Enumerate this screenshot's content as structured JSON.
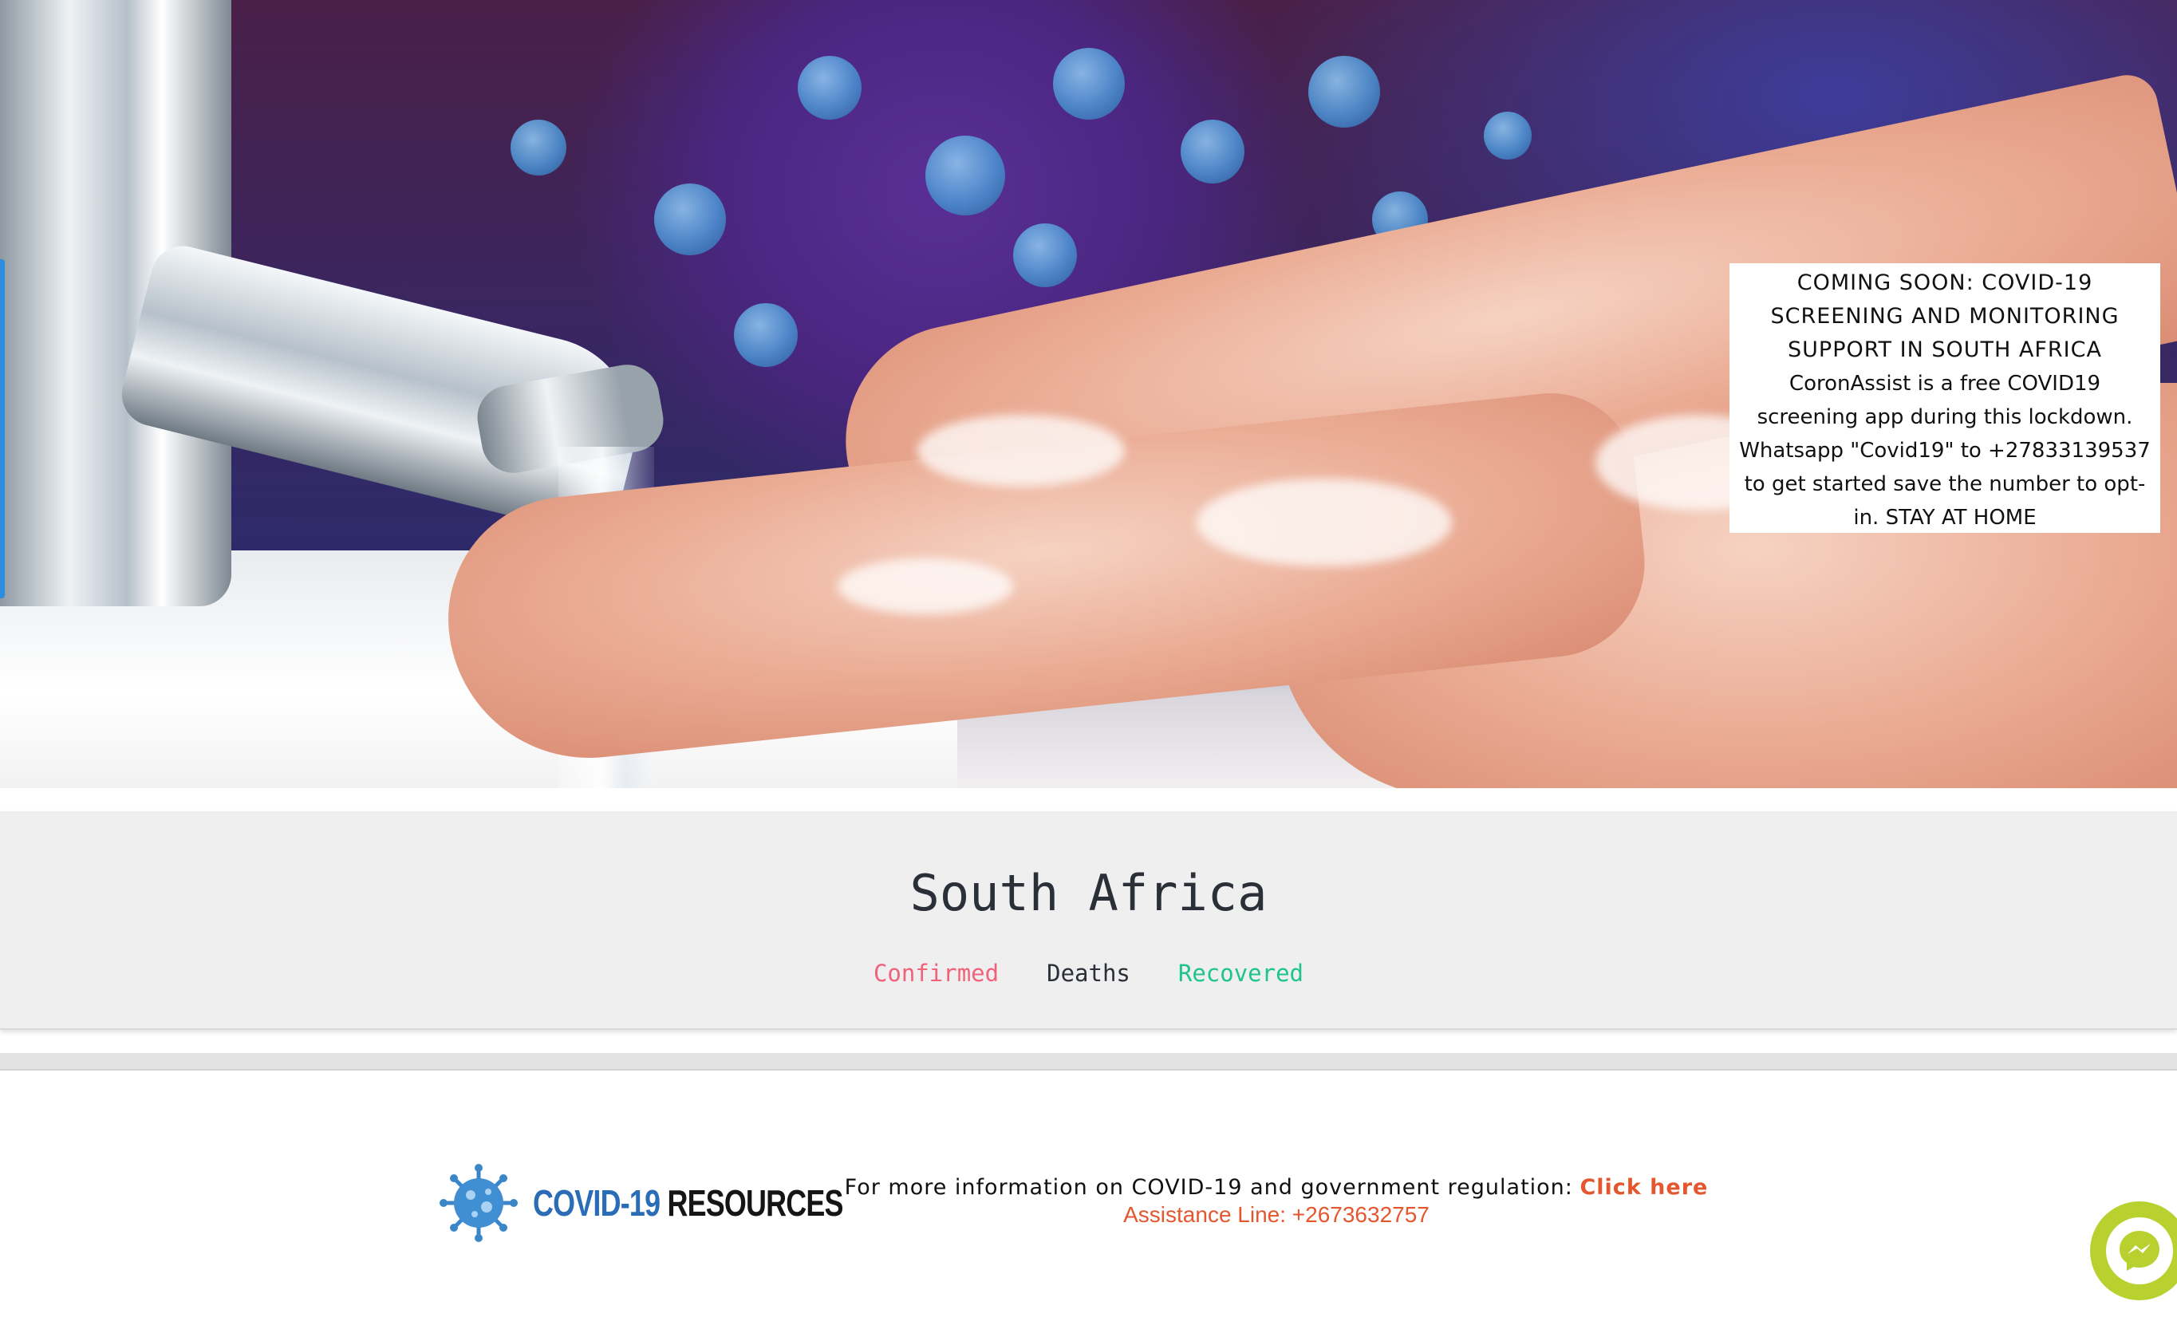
{
  "notice": {
    "title": "COMING SOON: COVID-19 SCREENING AND MONITORING SUPPORT IN SOUTH AFRICA",
    "body": "CoronAssist is a free COVID19 screening app during this lockdown. Whatsapp \"Covid19\" to +27833139537 to get started save the number to opt-in. STAY AT HOME"
  },
  "stats": {
    "country": "South Africa",
    "confirmed_label": "Confirmed",
    "deaths_label": "Deaths",
    "recovered_label": "Recovered",
    "colors": {
      "confirmed": "#f0627a",
      "deaths": "#2b3038",
      "recovered": "#1dc48c"
    }
  },
  "footer": {
    "resources_covid": "COVID-19",
    "resources_word": "RESOURCES",
    "info_text": "For more information on COVID-19 and government regulation:",
    "info_link": "Click here",
    "assistance": "Assistance Line: +2673632757",
    "accent_color": "#e4572e"
  },
  "icons": {
    "hero": "handwashing-virus-image",
    "resources_logo": "virus-icon",
    "chat": "messenger-icon"
  }
}
